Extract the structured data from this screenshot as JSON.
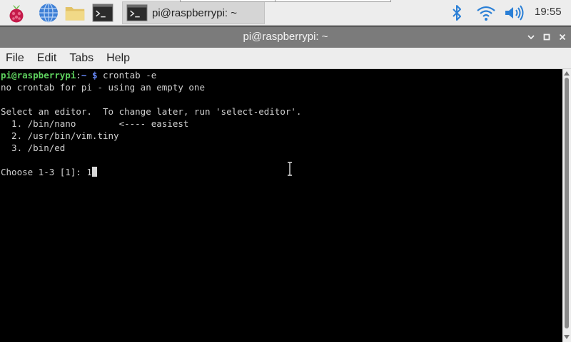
{
  "taskbar": {
    "launchers": [
      "raspberry-menu-icon",
      "web-browser-icon",
      "file-manager-icon",
      "terminal-icon"
    ],
    "task": {
      "label": "pi@raspberrypi: ~"
    },
    "clock": "19:55"
  },
  "window": {
    "title": "pi@raspberrypi: ~"
  },
  "menu": {
    "file": "File",
    "edit": "Edit",
    "tabs": "Tabs",
    "help": "Help"
  },
  "terminal": {
    "prompt": {
      "user": "pi@raspberrypi",
      "sep": ":",
      "path": "~",
      "dollar": " $",
      "command": " crontab -e"
    },
    "lines": [
      "no crontab for pi - using an empty one",
      "",
      "Select an editor.  To change later, run 'select-editor'.",
      "  1. /bin/nano        <---- easiest",
      "  2. /usr/bin/vim.tiny",
      "  3. /bin/ed",
      "",
      "Choose 1-3 [1]: 1"
    ]
  },
  "colors": {
    "prompt_user": "#5fd35f",
    "prompt_path": "#6a8cff",
    "titlebar": "#7b7b7b",
    "taskbar": "#ededed"
  }
}
